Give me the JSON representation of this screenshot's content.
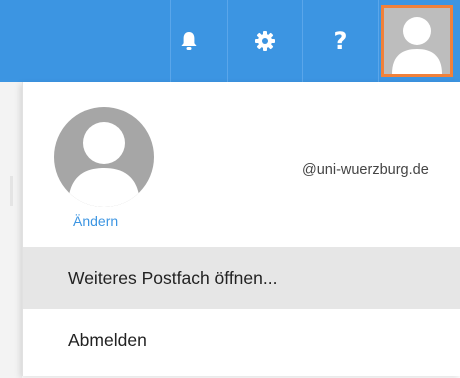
{
  "topbar": {
    "background": "#3c95e2",
    "icons": {
      "notifications": "bell-icon",
      "settings": "gear-icon",
      "help": "question-mark-icon",
      "account": "user-avatar-icon"
    },
    "help_glyph": "?",
    "account_active_border": "#f1813a"
  },
  "profile": {
    "change_label": "Ändern",
    "email": "@uni-wuerzburg.de"
  },
  "menu": {
    "items": [
      {
        "label": "Weiteres Postfach öffnen...",
        "highlighted": true
      },
      {
        "label": "Abmelden",
        "highlighted": false
      }
    ]
  },
  "colors": {
    "accent": "#3c95e2",
    "link": "#3c95e2",
    "highlight_row": "#e6e6e6"
  }
}
